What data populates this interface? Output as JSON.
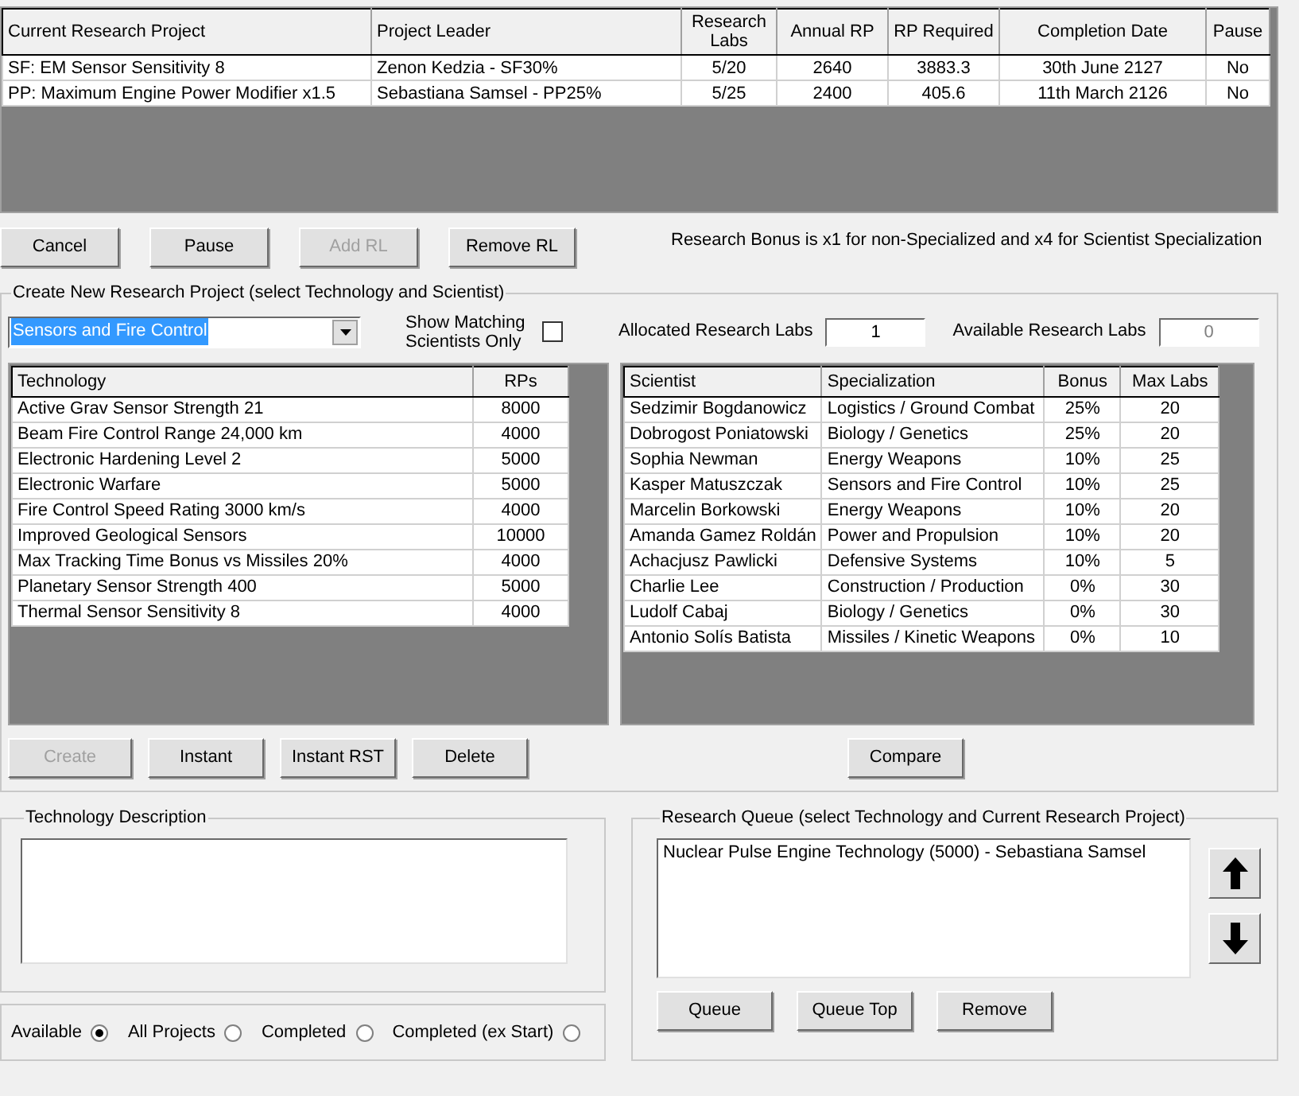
{
  "current_projects": {
    "columns": [
      "Current Research Project",
      "Project Leader",
      "Research Labs",
      "Annual RP",
      "RP Required",
      "Completion Date",
      "Pause"
    ],
    "rows": [
      [
        "SF: EM Sensor Sensitivity 8",
        "Zenon Kedzia  - SF30%",
        "5/20",
        "2640",
        "3883.3",
        "30th June 2127",
        "No"
      ],
      [
        "PP: Maximum Engine Power Modifier x1.5",
        "Sebastiana Samsel  - PP25%",
        "5/25",
        "2400",
        "405.6",
        "11th March 2126",
        "No"
      ]
    ]
  },
  "project_buttons": [
    {
      "label": "Cancel",
      "disabled": false
    },
    {
      "label": "Pause",
      "disabled": false
    },
    {
      "label": "Add RL",
      "disabled": true
    },
    {
      "label": "Remove RL",
      "disabled": false
    }
  ],
  "bonus_note": "Research Bonus is x1 for non-Specialized and x4 for Scientist Specialization",
  "create_project": {
    "title": "Create New Research Project (select Technology and Scientist)",
    "category_dropdown": {
      "value": "Sensors and Fire Control"
    },
    "show_matching": {
      "label": "Show Matching Scientists Only",
      "checked": false
    },
    "allocated_labs": {
      "label": "Allocated Research Labs",
      "value": "1"
    },
    "available_labs": {
      "label": "Available Research Labs",
      "value": "0"
    },
    "technologies": {
      "columns": [
        "Technology",
        "RPs"
      ],
      "rows": [
        [
          "Active Grav Sensor Strength 21",
          "8000"
        ],
        [
          "Beam Fire Control Range 24,000 km",
          "4000"
        ],
        [
          "Electronic Hardening Level 2",
          "5000"
        ],
        [
          "Electronic Warfare",
          "5000"
        ],
        [
          "Fire Control Speed Rating 3000 km/s",
          "4000"
        ],
        [
          "Improved Geological Sensors",
          "10000"
        ],
        [
          "Max Tracking Time Bonus vs Missiles 20%",
          "4000"
        ],
        [
          "Planetary Sensor Strength 400",
          "5000"
        ],
        [
          "Thermal Sensor Sensitivity 8",
          "4000"
        ]
      ]
    },
    "scientists": {
      "columns": [
        "Scientist",
        "Specialization",
        "Bonus",
        "Max Labs"
      ],
      "rows": [
        [
          "Sedzimir Bogdanowicz",
          "Logistics / Ground Combat",
          "25%",
          "20"
        ],
        [
          "Dobrogost Poniatowski",
          "Biology / Genetics",
          "25%",
          "20"
        ],
        [
          "Sophia Newman",
          "Energy Weapons",
          "10%",
          "25"
        ],
        [
          "Kasper Matuszczak",
          "Sensors and Fire Control",
          "10%",
          "25"
        ],
        [
          "Marcelin Borkowski",
          "Energy Weapons",
          "10%",
          "20"
        ],
        [
          "Amanda Gamez Roldán",
          "Power and Propulsion",
          "10%",
          "20"
        ],
        [
          "Achacjusz Pawlicki",
          "Defensive Systems",
          "10%",
          "5"
        ],
        [
          "Charlie Lee",
          "Construction / Production",
          "0%",
          "30"
        ],
        [
          "Ludolf Cabaj",
          "Biology / Genetics",
          "0%",
          "30"
        ],
        [
          "Antonio Solís Batista",
          "Missiles / Kinetic Weapons",
          "0%",
          "10"
        ]
      ]
    },
    "tech_buttons": [
      {
        "label": "Create",
        "disabled": true
      },
      {
        "label": "Instant",
        "disabled": false
      },
      {
        "label": "Instant RST",
        "disabled": false
      },
      {
        "label": "Delete",
        "disabled": false
      }
    ],
    "compare_button": {
      "label": "Compare",
      "disabled": false
    }
  },
  "technology_description": {
    "title": "Technology Description"
  },
  "filter": [
    {
      "label": "Available",
      "selected": true
    },
    {
      "label": "All Projects",
      "selected": false
    },
    {
      "label": "Completed",
      "selected": false
    },
    {
      "label": "Completed (ex Start)",
      "selected": false
    }
  ],
  "research_queue": {
    "title": "Research Queue (select Technology and Current Research Project)",
    "items": [
      "Nuclear Pulse Engine Technology (5000) - Sebastiana Samsel"
    ],
    "buttons": [
      {
        "label": "Queue",
        "disabled": false
      },
      {
        "label": "Queue Top",
        "disabled": false
      },
      {
        "label": "Remove",
        "disabled": false
      }
    ]
  }
}
